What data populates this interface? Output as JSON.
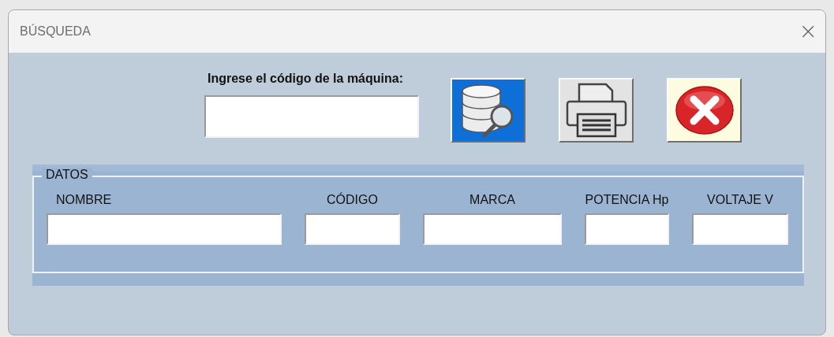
{
  "window": {
    "title": "BÚSQUEDA",
    "close_glyph": "×"
  },
  "search": {
    "label": "Ingrese el código de la máquina:"
  },
  "buttons": [
    {
      "kind": "search"
    },
    {
      "kind": "print"
    },
    {
      "kind": "close"
    }
  ],
  "group": {
    "title": "DATOS",
    "fields": [
      {
        "label": "NOMBRE"
      },
      {
        "label": "CÓDIGO"
      },
      {
        "label": "MARCA"
      },
      {
        "label": "POTENCIA Hp"
      },
      {
        "label": "VOLTAJE  V"
      }
    ]
  }
}
